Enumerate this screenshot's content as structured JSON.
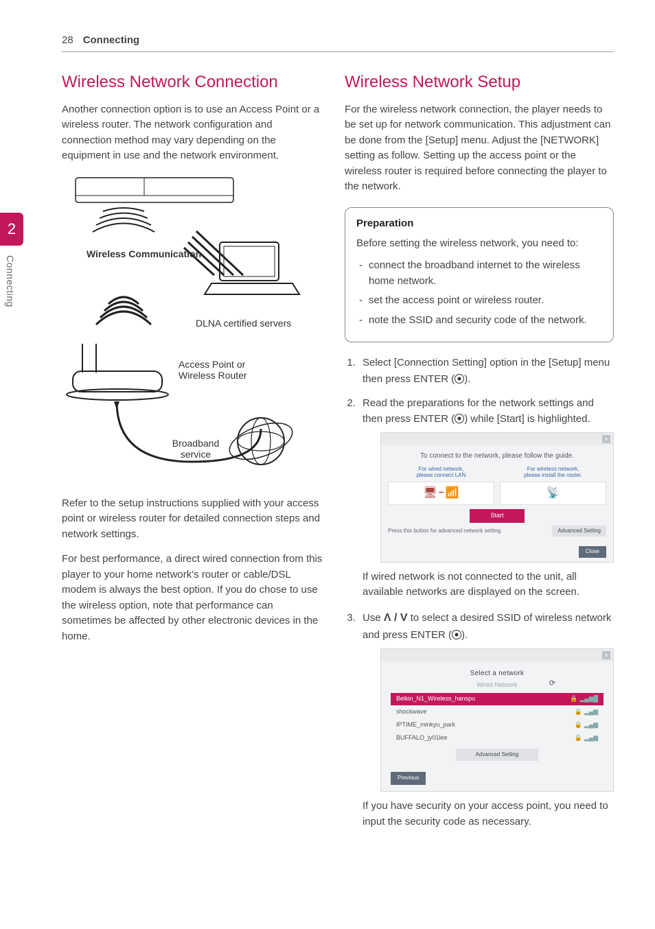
{
  "page": {
    "number": "28",
    "section": "Connecting",
    "side_tab_number": "2",
    "side_tab_label": "Connecting"
  },
  "left": {
    "heading": "Wireless Network Connection",
    "intro": "Another connection option is to use an Access Point or a wireless router. The network configuration and connection method may vary depending on the equipment in use and the network environment.",
    "diagram": {
      "wireless_comm": "Wireless Communication",
      "dlna": "DLNA certified servers",
      "access_point": "Access Point or Wireless Router",
      "broadband": "Broadband service"
    },
    "setup_ref": "Refer to the setup instructions supplied with your access point or wireless router for detailed connection steps and network settings.",
    "performance": "For best performance, a direct wired connection from this player to your home network's router or cable/DSL modem is always the best option. If you do chose to use the wireless option, note that performance can sometimes be affected by other electronic devices in the home."
  },
  "right": {
    "heading": "Wireless Network Setup",
    "intro": "For the wireless network connection, the player needs to be set up for network communication. This adjustment can be done from the [Setup] menu. Adjust the [NETWORK] setting as follow. Setting up the access point or the wireless router is required before connecting the player to the network.",
    "prep": {
      "title": "Preparation",
      "intro": "Before setting the wireless network, you need to:",
      "items": [
        "connect the broadband internet to the wireless home network.",
        "set the access point or wireless router.",
        "note the SSID and security code of the network."
      ]
    },
    "step1_a": "Select [Connection Setting] option in the [Setup] menu then press ENTER (",
    "step1_b": ").",
    "step2_a": "Read the preparations for the network settings and then press ENTER (",
    "step2_b": ") while [Start] is highlighted.",
    "ui1": {
      "title": "To connect to the network, please follow the guide.",
      "wired_a": "For wired network,",
      "wired_b": "please connect LAN",
      "wireless_a": "For wireless network,",
      "wireless_b": "please install the router.",
      "start": "Start",
      "footer_text": "Press this button for advanced network setting.",
      "adv": "Advanced Setting",
      "close": "Close"
    },
    "step2_note": "If wired network is not connected to the unit, all available networks are displayed on the screen.",
    "step3_a": "Use ",
    "step3_b": " to select a desired SSID of wireless network and press ENTER (",
    "step3_c": ").",
    "ui2": {
      "title": "Select a network",
      "wired": "Wired Network",
      "networks": [
        "Belkin_N1_Wireless_hanspu",
        "shockwave",
        "IPTIME_minkyu_park",
        "BUFFALO_jy01lee"
      ],
      "adv": "Advanced Setting",
      "prev": "Previous"
    },
    "step3_note": "If you have security on your access point, you need to input the security code as necessary."
  }
}
